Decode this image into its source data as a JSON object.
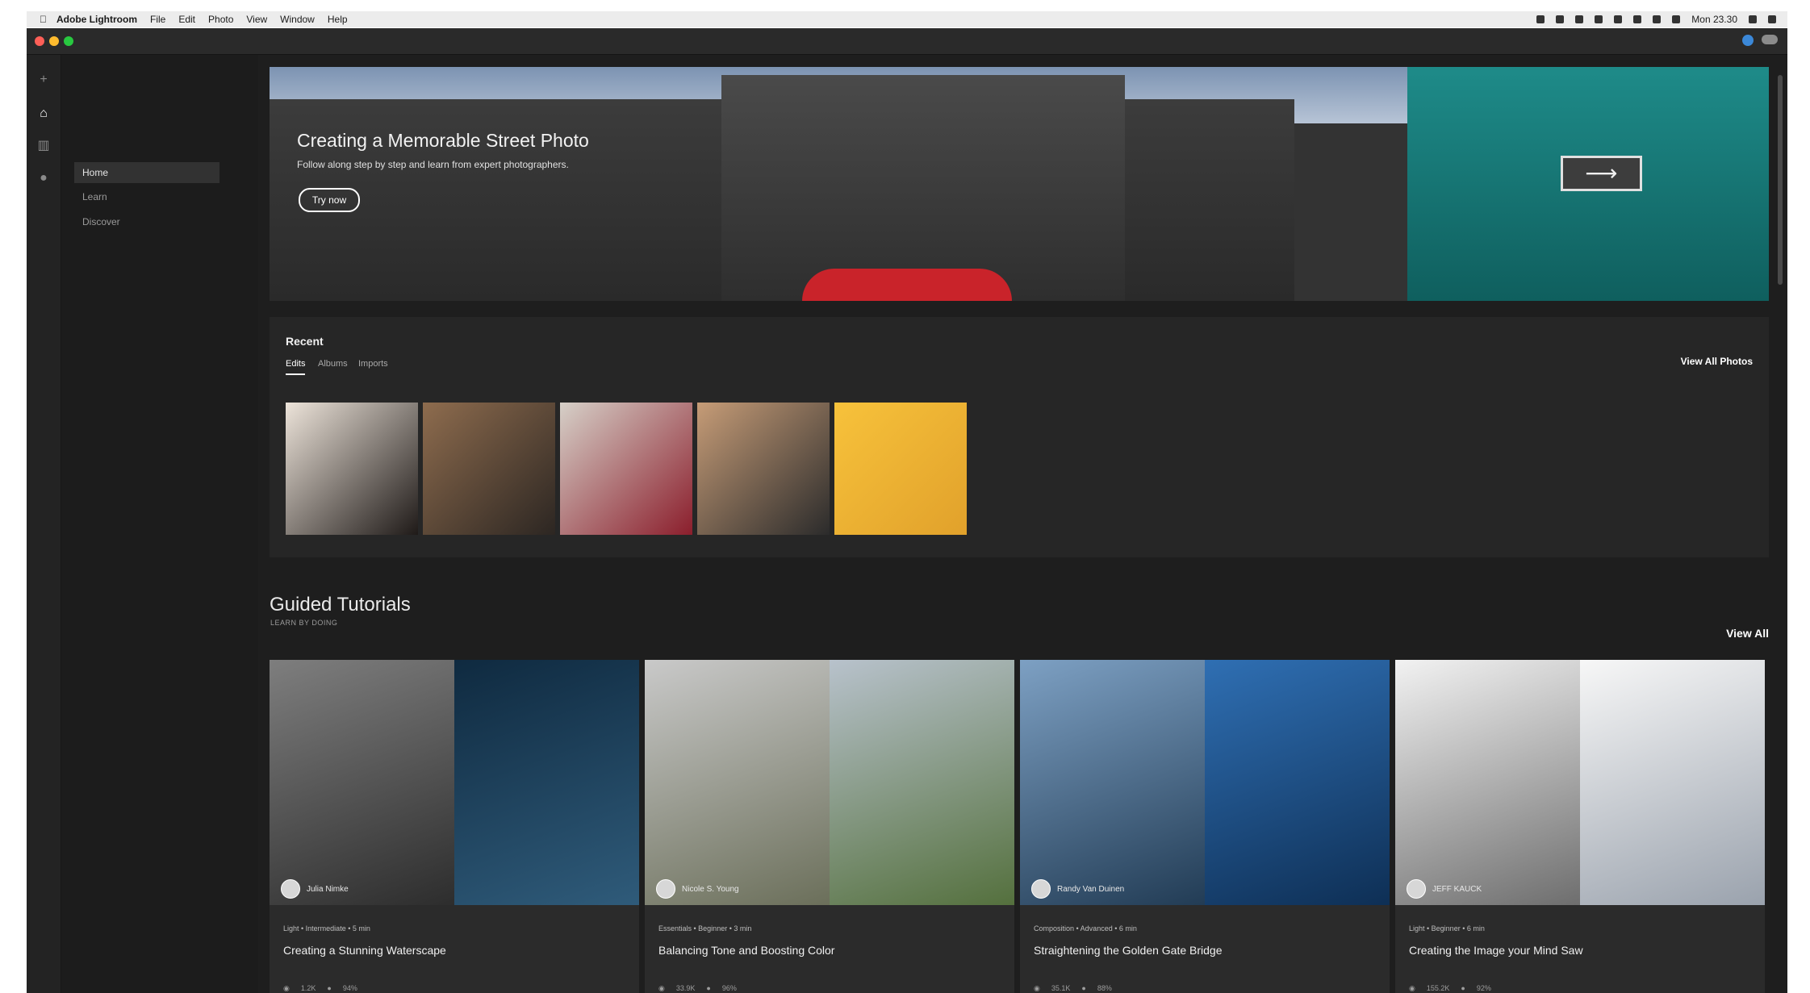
{
  "menubar": {
    "app": "Adobe Lightroom",
    "items": [
      "File",
      "Edit",
      "Photo",
      "View",
      "Window",
      "Help"
    ],
    "clock": "Mon 23.30"
  },
  "nav": {
    "items": [
      {
        "label": "Home",
        "active": true
      },
      {
        "label": "Learn",
        "active": false
      },
      {
        "label": "Discover",
        "active": false
      }
    ]
  },
  "hero": {
    "title": "Creating a Memorable Street Photo",
    "subtitle": "Follow along step by step and learn from expert photographers.",
    "button": "Try now"
  },
  "recent": {
    "title": "Recent",
    "tabs": [
      "Edits",
      "Albums",
      "Imports"
    ],
    "view_all_label": "View All Photos",
    "thumbs": [
      {
        "colors": [
          "#ede4da",
          "#1f1a18"
        ]
      },
      {
        "colors": [
          "#8e6c4e",
          "#2c2622"
        ]
      },
      {
        "colors": [
          "#d6d0c8",
          "#8b1e2c"
        ]
      },
      {
        "colors": [
          "#c69c77",
          "#2b2b2b"
        ]
      },
      {
        "colors": [
          "#f7c23b",
          "#e1a12b"
        ]
      }
    ]
  },
  "guided": {
    "title": "Guided Tutorials",
    "subtitle": "LEARN BY DOING",
    "view_all": "View All",
    "cards": [
      {
        "author": "Julia Nimke",
        "meta": "Light • Intermediate • 5 min",
        "title": "Creating a Stunning Waterscape",
        "views": "1.2K",
        "likes": "94%",
        "left": [
          "#7e7e7e",
          "#2d2d2d"
        ],
        "right": [
          "#0f2a40",
          "#2f5b7a"
        ]
      },
      {
        "author": "Nicole S. Young",
        "meta": "Essentials • Beginner • 3 min",
        "title": "Balancing Tone and Boosting Color",
        "views": "33.9K",
        "likes": "96%",
        "left": [
          "#c9c9c9",
          "#6b6f5a"
        ],
        "right": [
          "#b8c2cc",
          "#54703d"
        ]
      },
      {
        "author": "Randy Van Duinen",
        "meta": "Composition • Advanced • 6 min",
        "title": "Straightening the Golden Gate Bridge",
        "views": "35.1K",
        "likes": "88%",
        "left": [
          "#7da0c3",
          "#223c55"
        ],
        "right": [
          "#2f6fb3",
          "#0e2f55"
        ]
      },
      {
        "author": "JEFF KAUCK",
        "meta": "Light • Beginner • 6 min",
        "title": "Creating the Image your Mind Saw",
        "views": "155.2K",
        "likes": "92%",
        "left": [
          "#f2f2f2",
          "#6e6e6e"
        ],
        "right": [
          "#f7f7f7",
          "#9aa2ad"
        ]
      }
    ]
  }
}
